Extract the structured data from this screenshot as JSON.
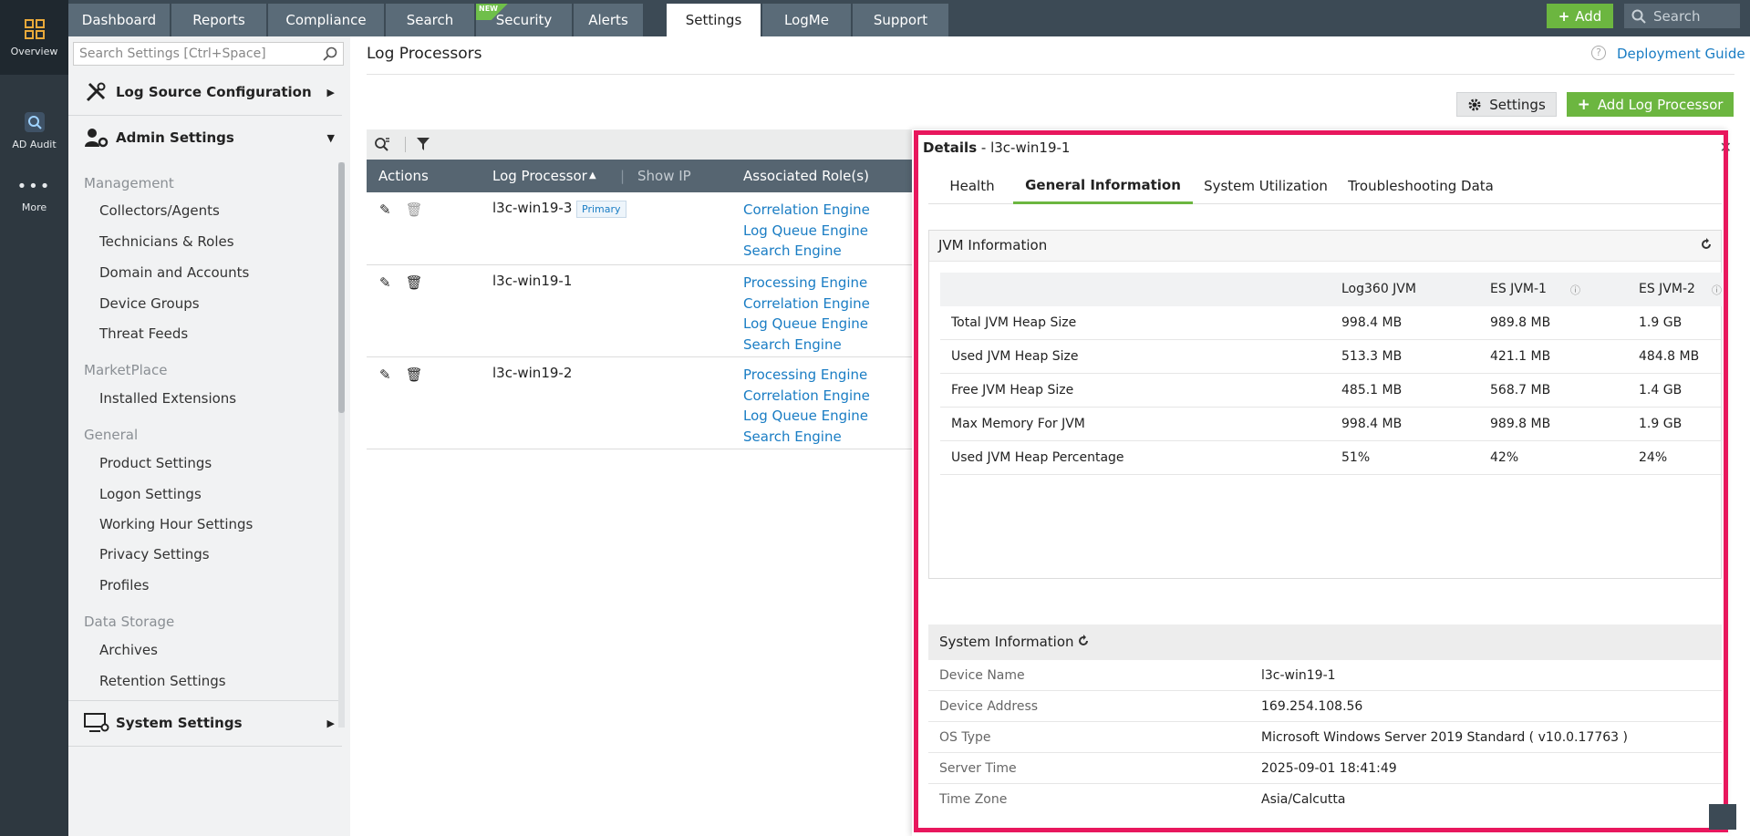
{
  "left_rail": {
    "items": [
      {
        "label": "Overview",
        "icon": "grid-icon"
      },
      {
        "label": "AD Audit",
        "icon": "audit-search-icon"
      },
      {
        "label": "More",
        "icon": "more-dots-icon"
      }
    ]
  },
  "topnav": {
    "tabs": [
      "Dashboard",
      "Reports",
      "Compliance",
      "Search",
      "Security",
      "Alerts",
      "Settings",
      "LogMe",
      "Support"
    ],
    "active_tab": "Settings",
    "new_badge": "NEW",
    "add_label": "Add",
    "search_placeholder": "Search"
  },
  "sidebar": {
    "search_placeholder": "Search Settings [Ctrl+Space]",
    "log_source": "Log Source Configuration",
    "admin_settings": "Admin Settings",
    "groups": [
      {
        "label": "Management",
        "items": [
          "Collectors/Agents",
          "Technicians & Roles",
          "Domain and Accounts",
          "Device Groups",
          "Threat Feeds"
        ]
      },
      {
        "label": "MarketPlace",
        "items": [
          "Installed Extensions"
        ]
      },
      {
        "label": "General",
        "items": [
          "Product Settings",
          "Logon Settings",
          "Working Hour Settings",
          "Privacy Settings",
          "Profiles"
        ]
      },
      {
        "label": "Data Storage",
        "items": [
          "Archives",
          "Retention Settings"
        ]
      }
    ],
    "system_settings": "System Settings"
  },
  "page": {
    "title": "Log Processors",
    "deployment_guide": "Deployment Guide",
    "settings_button": "Settings",
    "add_button": "Add Log Processor"
  },
  "table": {
    "headers": {
      "actions": "Actions",
      "processor": "Log Processor",
      "show_ip": "Show IP",
      "roles": "Associated Role(s)"
    },
    "rows": [
      {
        "name": "l3c-win19-3",
        "badge": "Primary",
        "roles": [
          "Correlation Engine",
          "Log Queue Engine",
          "Search Engine"
        ]
      },
      {
        "name": "l3c-win19-1",
        "badge": "",
        "roles": [
          "Processing Engine",
          "Correlation Engine",
          "Log Queue Engine",
          "Search Engine"
        ]
      },
      {
        "name": "l3c-win19-2",
        "badge": "",
        "roles": [
          "Processing Engine",
          "Correlation Engine",
          "Log Queue Engine",
          "Search Engine"
        ]
      }
    ]
  },
  "details": {
    "title_prefix": "Details",
    "title_name": " - l3c-win19-1",
    "tabs": [
      "Health",
      "General Information",
      "System Utilization",
      "Troubleshooting Data"
    ],
    "active_tab": "General Information",
    "jvm": {
      "title": "JVM Information",
      "columns": [
        "Log360 JVM",
        "ES JVM-1",
        "ES JVM-2"
      ],
      "rows": [
        {
          "label": "Total JVM Heap Size",
          "values": [
            "998.4 MB",
            "989.8 MB",
            "1.9 GB"
          ]
        },
        {
          "label": "Used JVM Heap Size",
          "values": [
            "513.3 MB",
            "421.1 MB",
            "484.8 MB"
          ]
        },
        {
          "label": "Free JVM Heap Size",
          "values": [
            "485.1 MB",
            "568.7 MB",
            "1.4 GB"
          ]
        },
        {
          "label": "Max Memory For JVM",
          "values": [
            "998.4 MB",
            "989.8 MB",
            "1.9 GB"
          ]
        },
        {
          "label": "Used JVM Heap Percentage",
          "values": [
            "51%",
            "42%",
            "24%"
          ]
        }
      ]
    },
    "system": {
      "title": "System Information",
      "rows": [
        {
          "key": "Device Name",
          "value": "l3c-win19-1"
        },
        {
          "key": "Device Address",
          "value": "169.254.108.56"
        },
        {
          "key": "OS Type",
          "value": "Microsoft Windows Server 2019 Standard ( v10.0.17763 )"
        },
        {
          "key": "Server Time",
          "value": "2025-09-01 18:41:49"
        },
        {
          "key": "Time Zone",
          "value": "Asia/Calcutta"
        }
      ]
    }
  },
  "colors": {
    "accent_green": "#6cb640",
    "link_blue": "#1a7dc4",
    "highlight": "#e8175d",
    "nav_dark": "#3c4a55"
  }
}
